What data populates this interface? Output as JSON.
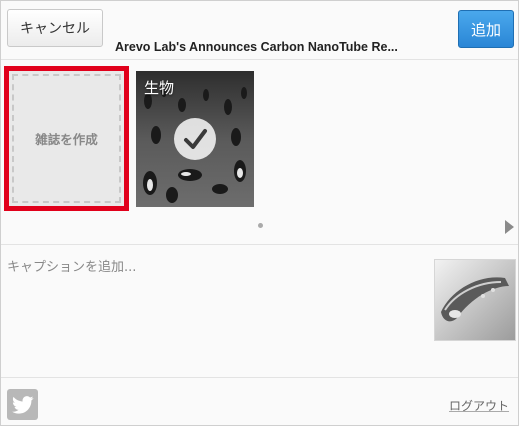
{
  "header": {
    "cancel_label": "キャンセル",
    "title": "Arevo Lab's Announces Carbon NanoTube Re...",
    "add_label": "追加"
  },
  "carousel": {
    "create_label": "雑誌を作成",
    "magazines": [
      {
        "label": "生物",
        "selected": true
      }
    ],
    "page_count": 1,
    "current_page": 1
  },
  "caption": {
    "placeholder": "キャプションを追加..."
  },
  "footer": {
    "logout_label": "ログアウト",
    "share_service_icon": "twitter-icon"
  },
  "colors": {
    "accent_blue": "#2f8fdb",
    "highlight_red": "#e1001b"
  }
}
